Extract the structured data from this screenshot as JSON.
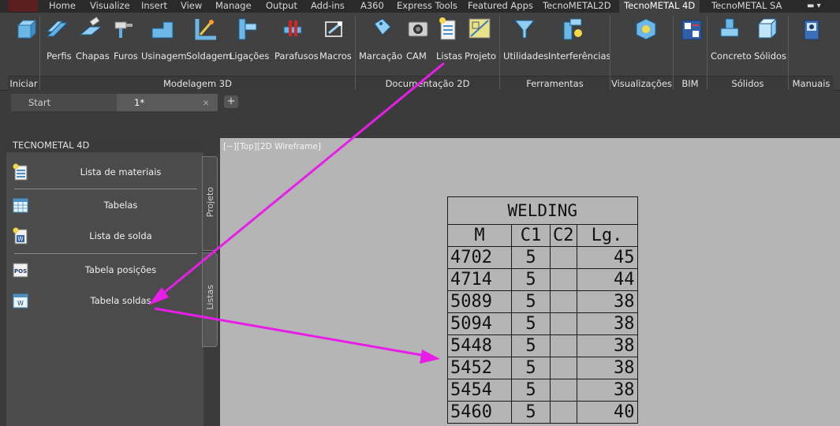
{
  "ribbon_tabs": [
    "Home",
    "Visualize",
    "Insert",
    "View",
    "Manage",
    "Output",
    "Add-ins",
    "A360",
    "Express Tools",
    "Featured Apps",
    "TecnoMETAL2D",
    "TecnoMETAL 4D",
    "TecnoMETAL SA"
  ],
  "active_tab": "TecnoMETAL 4D",
  "ribbon_buttons": [
    "Perfis",
    "Chapas",
    "Furos",
    "Usinagem",
    "Soldagem",
    "Ligações",
    "Parafusos",
    "Macros",
    "Marcação",
    "CAM",
    "Listas",
    "Projeto",
    "Utilidades",
    "Interferências",
    "Concreto",
    "Sólidos"
  ],
  "ribbon_panels": [
    "Iniciar",
    "Modelagem 3D",
    "Documentação 2D",
    "Ferramentas",
    "Visualizações",
    "BIM",
    "Sólidos",
    "Manuais"
  ],
  "doc_tabs": {
    "start": "Start",
    "drawing": "1*",
    "close": "×",
    "new": "+"
  },
  "palette": {
    "title": "TECNOMETAL 4D",
    "items": [
      "Lista de materiais",
      "Tabelas",
      "Lista de solda",
      "Tabela posições",
      "Tabela soldas"
    ],
    "side_tabs": [
      "Projeto",
      "Listas"
    ]
  },
  "viewport_label": "[−][Top][2D Wireframe]",
  "welding_table": {
    "title": "WELDING",
    "headers": [
      "M",
      "C1",
      "C2",
      "Lg."
    ],
    "rows": [
      [
        "4702",
        "5",
        "",
        "45"
      ],
      [
        "4714",
        "5",
        "",
        "44"
      ],
      [
        "5089",
        "5",
        "",
        "38"
      ],
      [
        "5094",
        "5",
        "",
        "38"
      ],
      [
        "5448",
        "5",
        "",
        "38"
      ],
      [
        "5452",
        "5",
        "",
        "38"
      ],
      [
        "5454",
        "5",
        "",
        "38"
      ],
      [
        "5460",
        "5",
        "",
        "40"
      ]
    ]
  },
  "colors": {
    "arrow": "#e81ee8",
    "ribbon": "#414141",
    "canvas": "#b5b5b5",
    "palette": "#4b4b4b"
  }
}
